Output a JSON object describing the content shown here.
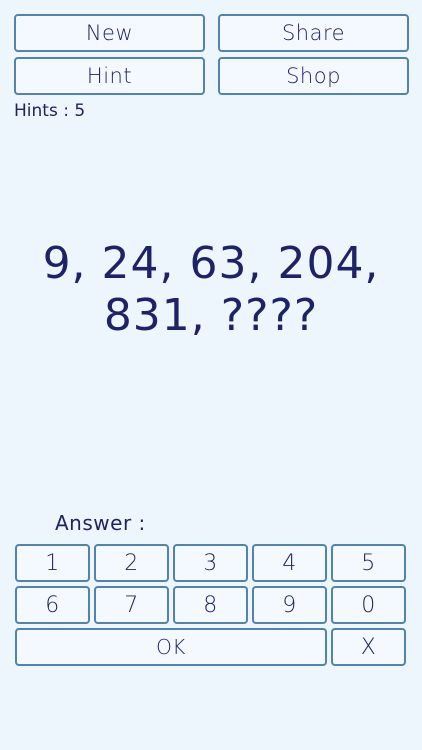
{
  "toolbar": {
    "new_label": "New",
    "share_label": "Share",
    "hint_label": "Hint",
    "shop_label": "Shop"
  },
  "hints": {
    "label": "Hints : ",
    "count": "5"
  },
  "puzzle": {
    "line1": "9, 24, 63, 204,",
    "line2": "831, ????"
  },
  "answer": {
    "label": "Answer :"
  },
  "keypad": {
    "keys": [
      "1",
      "2",
      "3",
      "4",
      "5",
      "6",
      "7",
      "8",
      "9",
      "0"
    ],
    "ok_label": "OK",
    "clear_label": "X"
  },
  "colors": {
    "background": "#eef6fd",
    "button_border": "#5383a8",
    "text": "#1d2366"
  }
}
